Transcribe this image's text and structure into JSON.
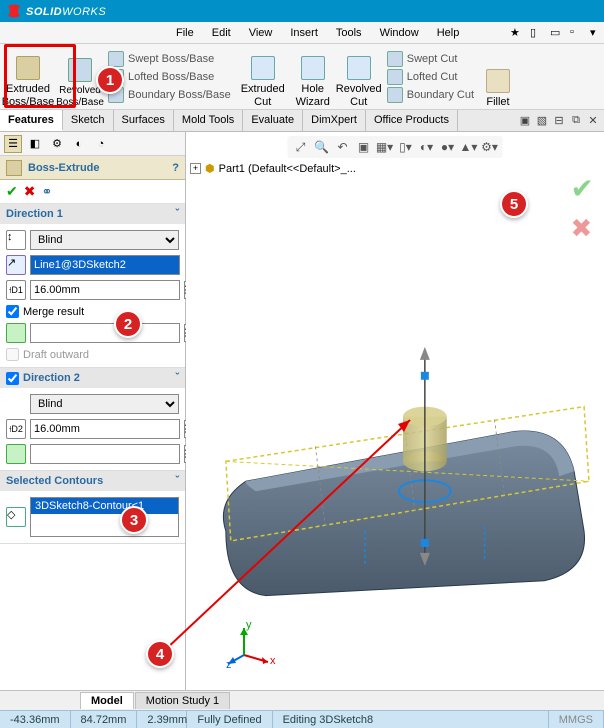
{
  "brand": {
    "name_bold": "SOLID",
    "name_light": "WORKS"
  },
  "menu": {
    "file": "File",
    "edit": "Edit",
    "view": "View",
    "insert": "Insert",
    "tools": "Tools",
    "window": "Window",
    "help": "Help"
  },
  "menu_extras": {
    "star": "★",
    "new": "▱",
    "open": "▭",
    "save": "▭",
    "print": "▭",
    "rebuild": "▭",
    "options": "▭"
  },
  "ribbon": {
    "extruded_boss": "Extruded Boss/Base",
    "revolved_boss": "Revolved Boss/Base",
    "swept_boss": "Swept Boss/Base",
    "lofted_boss": "Lofted Boss/Base",
    "boundary_boss": "Boundary Boss/Base",
    "extruded_cut": "Extruded Cut",
    "hole_wizard": "Hole Wizard",
    "revolved_cut": "Revolved Cut",
    "swept_cut": "Swept Cut",
    "lofted_cut": "Lofted Cut",
    "boundary_cut": "Boundary Cut",
    "fillet": "Fillet"
  },
  "tabs": {
    "features": "Features",
    "sketch": "Sketch",
    "surfaces": "Surfaces",
    "mold": "Mold Tools",
    "evaluate": "Evaluate",
    "dimxpert": "DimXpert",
    "office": "Office Products"
  },
  "tab_extras": {
    "a": "▣",
    "b": "▧",
    "c": "⊟",
    "d": "⧉",
    "e": "✕"
  },
  "feature": {
    "title": "Boss-Extrude",
    "help": "?",
    "ok": "✔",
    "cancel": "✖",
    "detail": "⚭"
  },
  "dir1": {
    "header": "Direction 1",
    "end_condition": "Blind",
    "direction_ref": "Line1@3DSketch2",
    "depth": "16.00mm",
    "merge": "Merge result",
    "draft_outward": "Draft outward"
  },
  "dir2": {
    "header": "Direction 2",
    "end_condition": "Blind",
    "depth": "16.00mm"
  },
  "contours": {
    "header": "Selected Contours",
    "item": "3DSketch8-Contour<1"
  },
  "tree": {
    "root": "Part1 (Default<<Default>_..."
  },
  "bottom": {
    "model": "Model",
    "motion": "Motion Study 1"
  },
  "status": {
    "x": "-43.36mm",
    "y": "84.72mm",
    "z": "2.39mm",
    "state": "Fully Defined",
    "mode": "Editing 3DSketch8",
    "units": "MMGS"
  },
  "badges": {
    "b1": "1",
    "b2": "2",
    "b3": "3",
    "b4": "4",
    "b5": "5"
  }
}
